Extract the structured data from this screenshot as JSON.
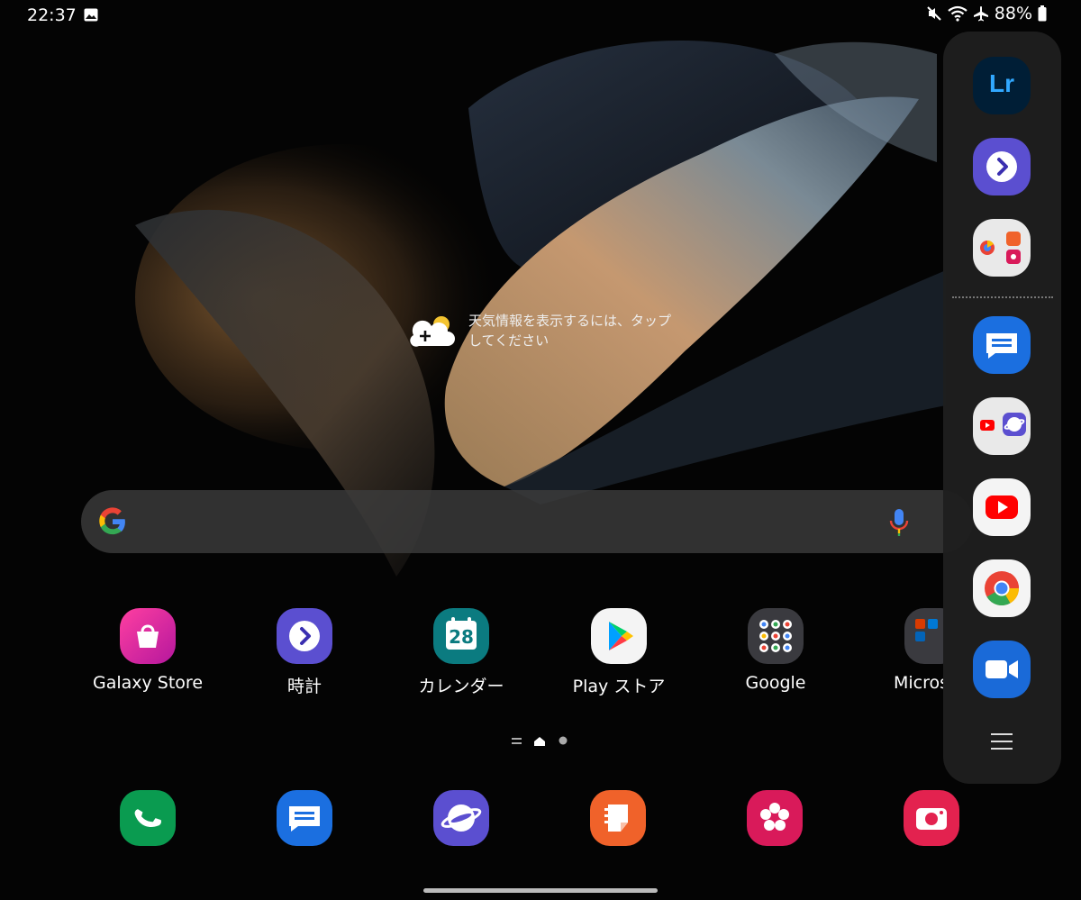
{
  "status_bar": {
    "time": "22:37",
    "battery": "88%",
    "icons": [
      "gallery-icon",
      "mute-icon",
      "wifi-icon",
      "airplane-icon",
      "battery-icon"
    ]
  },
  "weather": {
    "text": "天気情報を表示するには、タップしてください",
    "icon": "weather-add-icon"
  },
  "search": {
    "icons": [
      "google-logo",
      "mic-icon"
    ]
  },
  "home_apps": [
    {
      "label": "Galaxy Store",
      "icon": "galaxy-store-icon"
    },
    {
      "label": "時計",
      "icon": "clock-icon"
    },
    {
      "label": "カレンダー",
      "icon": "calendar-icon",
      "badge": "28"
    },
    {
      "label": "Play ストア",
      "icon": "play-store-icon"
    },
    {
      "label": "Google",
      "icon": "google-folder-icon"
    },
    {
      "label": "Micros",
      "icon": "microsoft-folder-icon"
    }
  ],
  "dock": [
    "phone-icon",
    "messages-icon",
    "samsung-internet-icon",
    "samsung-notes-icon",
    "bixby-flower-icon",
    "camera-icon"
  ],
  "edge_panel": {
    "lightroom_label": "Lr",
    "apps": [
      "lightroom-icon",
      "clock-icon",
      "app-pair-icon",
      "messages-icon",
      "app-pair-2-icon",
      "youtube-icon",
      "chrome-icon",
      "zoom-icon"
    ],
    "menu_icon": "menu-icon"
  },
  "colors": {
    "search_bg": "#3c3c3c",
    "edge_panel_bg": "#1e1e1e",
    "lightroom": "#001e36",
    "clock": "#5b4fd0",
    "messages": "#1b6fe0",
    "youtube": "#ff0000",
    "zoom": "#1a6ad8"
  }
}
